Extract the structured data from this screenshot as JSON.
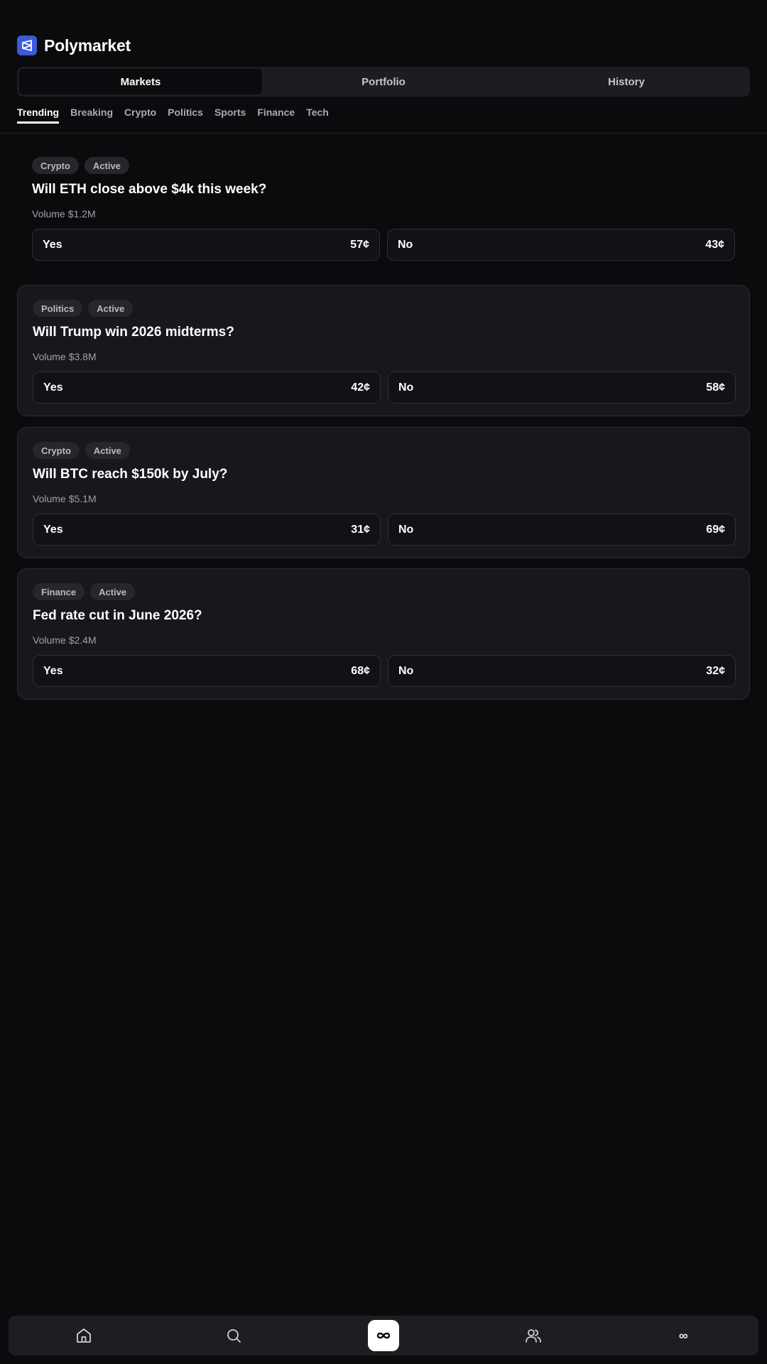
{
  "app": {
    "title": "Polymarket"
  },
  "segments": [
    {
      "label": "Markets",
      "active": true
    },
    {
      "label": "Portfolio",
      "active": false
    },
    {
      "label": "History",
      "active": false
    }
  ],
  "categories": [
    {
      "label": "Trending",
      "active": true
    },
    {
      "label": "Breaking"
    },
    {
      "label": "Crypto"
    },
    {
      "label": "Politics"
    },
    {
      "label": "Sports"
    },
    {
      "label": "Finance"
    },
    {
      "label": "Tech"
    }
  ],
  "markets": [
    {
      "category": "Crypto",
      "status": "Active",
      "title": "Will ETH close above $4k this week?",
      "volume_label": "Volume",
      "volume": "$1.2M",
      "yes_label": "Yes",
      "yes_price": "57¢",
      "no_label": "No",
      "no_price": "43¢"
    },
    {
      "category": "Politics",
      "status": "Active",
      "title": "Will Trump win 2026 midterms?",
      "volume_label": "Volume",
      "volume": "$3.8M",
      "yes_label": "Yes",
      "yes_price": "42¢",
      "no_label": "No",
      "no_price": "58¢"
    },
    {
      "category": "Crypto",
      "status": "Active",
      "title": "Will BTC reach $150k by July?",
      "volume_label": "Volume",
      "volume": "$5.1M",
      "yes_label": "Yes",
      "yes_price": "31¢",
      "no_label": "No",
      "no_price": "69¢"
    },
    {
      "category": "Finance",
      "status": "Active",
      "title": "Fed rate cut in June 2026?",
      "volume_label": "Volume",
      "volume": "$2.4M",
      "yes_label": "Yes",
      "yes_price": "68¢",
      "no_label": "No",
      "no_price": "32¢"
    }
  ],
  "bottom_nav": [
    {
      "icon": "home-icon"
    },
    {
      "icon": "search-icon"
    },
    {
      "icon": "infinity-icon",
      "active": true
    },
    {
      "icon": "users-icon"
    },
    {
      "label": "∞"
    }
  ],
  "colors": {
    "background": "#0a0b0d",
    "brand": "#3b5bdb",
    "card": "#17181b"
  }
}
